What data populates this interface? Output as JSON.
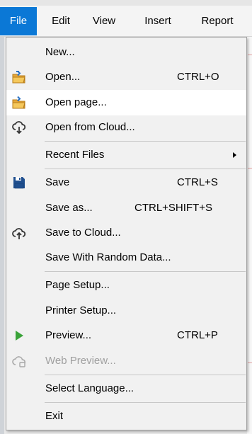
{
  "menubar": {
    "file": "File",
    "edit": "Edit",
    "view": "View",
    "insert": "Insert",
    "report": "Report"
  },
  "file_menu": {
    "new": "New...",
    "open": "Open...",
    "open_shortcut": "CTRL+O",
    "open_page": "Open page...",
    "open_cloud": "Open from Cloud...",
    "recent_files": "Recent Files",
    "save": "Save",
    "save_shortcut": "CTRL+S",
    "save_as": "Save as...",
    "save_as_shortcut": "CTRL+SHIFT+S",
    "save_cloud": "Save to Cloud...",
    "save_random": "Save With Random Data...",
    "page_setup": "Page Setup...",
    "printer_setup": "Printer Setup...",
    "preview": "Preview...",
    "preview_shortcut": "CTRL+P",
    "web_preview": "Web Preview...",
    "select_language": "Select Language...",
    "exit": "Exit"
  },
  "icons": {
    "open": "folder-open-icon",
    "open_page": "folder-open-icon",
    "open_cloud": "cloud-download-icon",
    "save": "floppy-disk-icon",
    "save_cloud": "cloud-upload-icon",
    "preview": "play-icon",
    "web_preview": "cloud-web-icon"
  },
  "colors": {
    "menubar_active": "#0b78d6",
    "hover_row": "#ffffff",
    "menu_bg": "#f1f1f1",
    "save_icon": "#1f4f8f",
    "preview_icon": "#3aa339",
    "disabled_text": "#a0a0a0"
  }
}
